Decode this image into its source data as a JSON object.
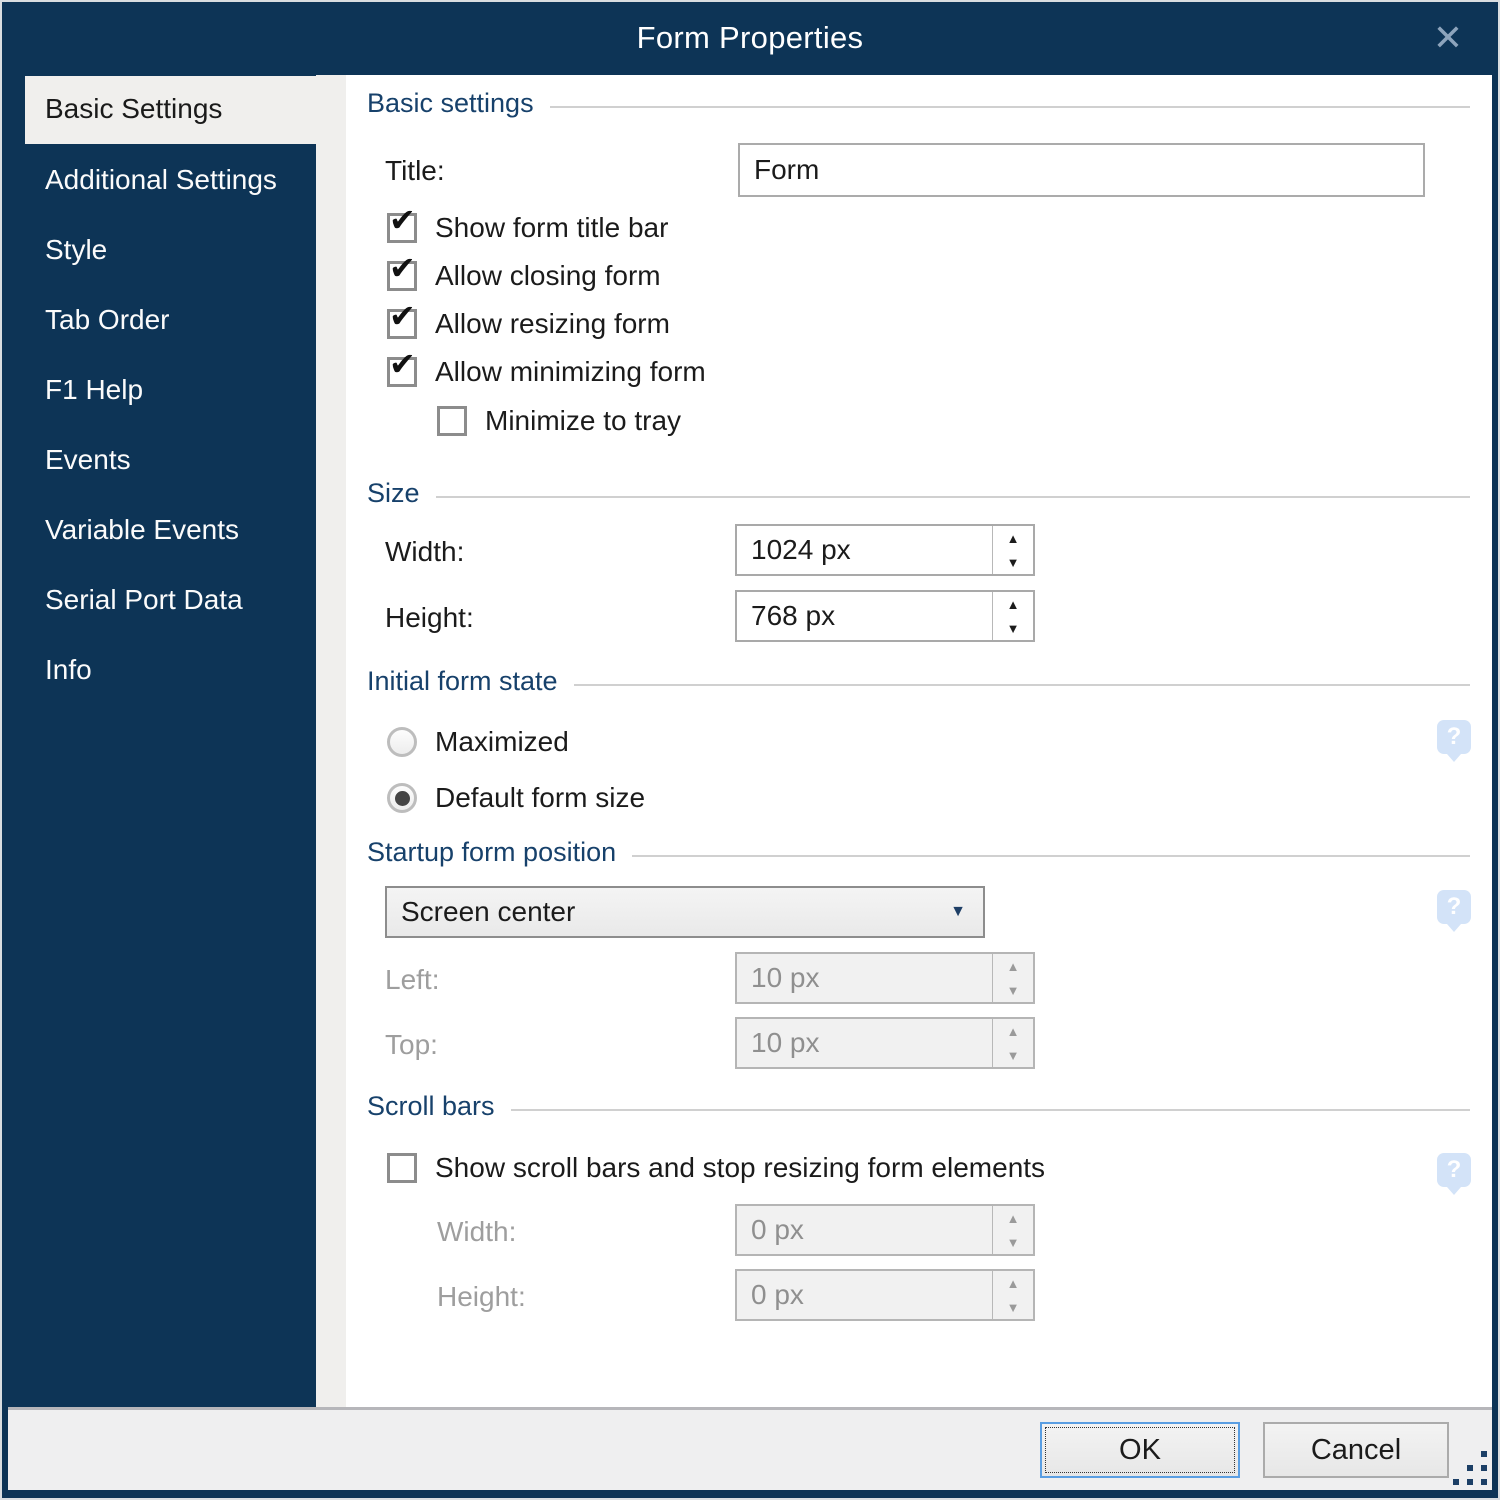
{
  "window": {
    "title": "Form Properties"
  },
  "icons": {
    "close": "✕",
    "check": "✔",
    "up": "▲",
    "down": "▼",
    "dropdown": "▼",
    "help": "?"
  },
  "sidebar": {
    "items": [
      {
        "label": "Basic Settings",
        "selected": true
      },
      {
        "label": "Additional Settings",
        "selected": false
      },
      {
        "label": "Style",
        "selected": false
      },
      {
        "label": "Tab Order",
        "selected": false
      },
      {
        "label": "F1 Help",
        "selected": false
      },
      {
        "label": "Events",
        "selected": false
      },
      {
        "label": "Variable Events",
        "selected": false
      },
      {
        "label": "Serial Port Data",
        "selected": false
      },
      {
        "label": "Info",
        "selected": false
      }
    ]
  },
  "basic": {
    "heading": "Basic settings",
    "title_label": "Title:",
    "title_value": "Form",
    "checkboxes": [
      {
        "label": "Show form title bar",
        "checked": true
      },
      {
        "label": "Allow closing form",
        "checked": true
      },
      {
        "label": "Allow resizing form",
        "checked": true
      },
      {
        "label": "Allow minimizing form",
        "checked": true
      },
      {
        "label": "Minimize to tray",
        "checked": false
      }
    ]
  },
  "size": {
    "heading": "Size",
    "width_label": "Width:",
    "width_value": "1024 px",
    "height_label": "Height:",
    "height_value": "768 px"
  },
  "initial_state": {
    "heading": "Initial form state",
    "options": [
      {
        "label": "Maximized",
        "selected": false
      },
      {
        "label": "Default form size",
        "selected": true
      }
    ]
  },
  "startup": {
    "heading": "Startup form position",
    "position_value": "Screen center",
    "left_label": "Left:",
    "left_value": "10 px",
    "top_label": "Top:",
    "top_value": "10 px"
  },
  "scrollbars": {
    "heading": "Scroll bars",
    "checkbox_label": "Show scroll bars and stop resizing form elements",
    "checkbox_checked": false,
    "width_label": "Width:",
    "width_value": "0 px",
    "height_label": "Height:",
    "height_value": "0 px"
  },
  "footer": {
    "ok_label": "OK",
    "cancel_label": "Cancel"
  },
  "colors": {
    "navy": "#0d3456",
    "selected_tab_bg": "#f0efed",
    "heading_blue": "#17416b",
    "help_bubble": "#d3e3f8",
    "ok_focus_border": "#5a9ee2",
    "footer_bg": "#efeff0",
    "disabled_text": "#9e9e9e"
  }
}
